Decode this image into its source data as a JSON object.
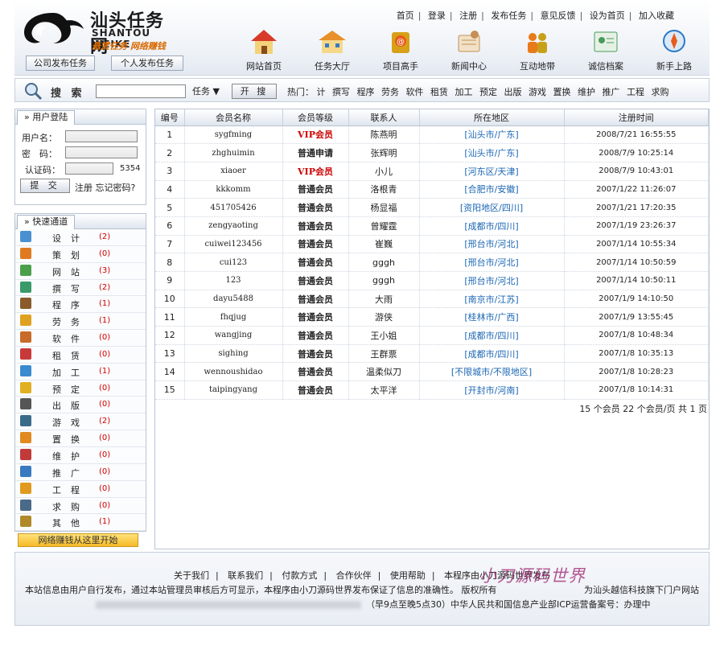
{
  "logo": {
    "cn": "汕头任务网",
    "en": "SHANTOU WEIKE",
    "slogan": "悬赏任务 网络赚钱"
  },
  "publish_buttons": {
    "company": "公司发布任务",
    "personal": "个人发布任务"
  },
  "top_links": [
    "首页",
    "登录",
    "注册",
    "发布任务",
    "意见反馈",
    "设为首页",
    "加入收藏"
  ],
  "nav": [
    {
      "label": "网站首页",
      "icon": "house-icon",
      "color": "#d83a2a"
    },
    {
      "label": "任务大厅",
      "icon": "hall-icon",
      "color": "#e8902a"
    },
    {
      "label": "项目高手",
      "icon": "expert-icon",
      "color": "#d7a018"
    },
    {
      "label": "新闻中心",
      "icon": "news-icon",
      "color": "#c78f55"
    },
    {
      "label": "互动地带",
      "icon": "people-icon",
      "color": "#e87a1a"
    },
    {
      "label": "诚信档案",
      "icon": "certificate-icon",
      "color": "#4a9a5a"
    },
    {
      "label": "新手上路",
      "icon": "compass-icon",
      "color": "#2a78c8"
    }
  ],
  "search": {
    "title": "搜 索",
    "input_value": "",
    "type_value": "任务",
    "button": "开 搜",
    "hot_label": "热门：",
    "hot": [
      "计",
      "撰写",
      "程序",
      "劳务",
      "软件",
      "租赁",
      "加工",
      "预定",
      "出版",
      "游戏",
      "置换",
      "维护",
      "推广",
      "工程",
      "求购"
    ]
  },
  "login": {
    "title": "用户登陆",
    "username_label": "用户名：",
    "password_label": "密　码：",
    "code_label": "认证码：",
    "code": "5354",
    "submit": "提 交",
    "register": "注册",
    "forgot": "忘记密码?"
  },
  "quick": {
    "title": "快速通道",
    "items": [
      {
        "name": "设计",
        "count": "(2)",
        "color": "#4a90d0"
      },
      {
        "name": "策划",
        "count": "(0)",
        "color": "#e07a20"
      },
      {
        "name": "网站",
        "count": "(3)",
        "color": "#4aa04a"
      },
      {
        "name": "撰写",
        "count": "(2)",
        "color": "#3a9a6a"
      },
      {
        "name": "程序",
        "count": "(1)",
        "color": "#8a5a2a"
      },
      {
        "name": "劳务",
        "count": "(1)",
        "color": "#e0a020"
      },
      {
        "name": "软件",
        "count": "(0)",
        "color": "#c86a2a"
      },
      {
        "name": "租赁",
        "count": "(0)",
        "color": "#c83a3a"
      },
      {
        "name": "加工",
        "count": "(1)",
        "color": "#3a8ad0"
      },
      {
        "name": "预定",
        "count": "(0)",
        "color": "#e0b020"
      },
      {
        "name": "出版",
        "count": "(0)",
        "color": "#555555"
      },
      {
        "name": "游戏",
        "count": "(2)",
        "color": "#3a6a8a"
      },
      {
        "name": "置换",
        "count": "(0)",
        "color": "#e08a20"
      },
      {
        "name": "维护",
        "count": "(0)",
        "color": "#c03a3a"
      },
      {
        "name": "推广",
        "count": "(0)",
        "color": "#3a7ac0"
      },
      {
        "name": "工程",
        "count": "(0)",
        "color": "#e09a20"
      },
      {
        "name": "求购",
        "count": "(0)",
        "color": "#4a6a8a"
      },
      {
        "name": "其他",
        "count": "(1)",
        "color": "#b08a2a"
      }
    ],
    "banner": "网络赚钱从这里开始"
  },
  "table": {
    "headers": [
      "编号",
      "会员名称",
      "会员等级",
      "联系人",
      "所在地区",
      "注册时间"
    ],
    "rows": [
      [
        "1",
        "sygfming",
        "VIP会员",
        "陈燕明",
        "[汕头市/广东]",
        "2008/7/21 16:55:55"
      ],
      [
        "2",
        "zhghuimin",
        "普通申请",
        "张辉明",
        "[汕头市/广东]",
        "2008/7/9 10:25:14"
      ],
      [
        "3",
        "xiaoer",
        "VIP会员",
        "小儿",
        "[河东区/天津]",
        "2008/7/9 10:43:01"
      ],
      [
        "4",
        "kkkomm",
        "普通会员",
        "洛根青",
        "[合肥市/安徽]",
        "2007/1/22 11:26:07"
      ],
      [
        "5",
        "451705426",
        "普通会员",
        "杨显福",
        "[资阳地区/四川]",
        "2007/1/21 17:20:35"
      ],
      [
        "6",
        "zengyaoting",
        "普通会员",
        "曾耀霆",
        "[成都市/四川]",
        "2007/1/19 23:26:37"
      ],
      [
        "7",
        "cuiwei123456",
        "普通会员",
        "崔巍",
        "[邢台市/河北]",
        "2007/1/14 10:55:34"
      ],
      [
        "8",
        "cui123",
        "普通会员",
        "gggh",
        "[邢台市/河北]",
        "2007/1/14 10:50:59"
      ],
      [
        "9",
        "123",
        "普通会员",
        "gggh",
        "[邢台市/河北]",
        "2007/1/14 10:50:11"
      ],
      [
        "10",
        "dayu5488",
        "普通会员",
        "大雨",
        "[南京市/江苏]",
        "2007/1/9 14:10:50"
      ],
      [
        "11",
        "fhqjug",
        "普通会员",
        "游侠",
        "[桂林市/广西]",
        "2007/1/9 13:55:45"
      ],
      [
        "12",
        "wangjing",
        "普通会员",
        "王小姐",
        "[成都市/四川]",
        "2007/1/8 10:48:34"
      ],
      [
        "13",
        "sighing",
        "普通会员",
        "王群票",
        "[成都市/四川]",
        "2007/1/8 10:35:13"
      ],
      [
        "14",
        "wennoushidao",
        "普通会员",
        "温柔似刀",
        "[不限城市/不限地区]",
        "2007/1/8 10:28:23"
      ],
      [
        "15",
        "taipingyang",
        "普通会员",
        "太平洋",
        "[开封市/河南]",
        "2007/1/8 10:14:31"
      ]
    ],
    "pager": "15 个会员  22 个会员/页  共 1 页"
  },
  "footer": {
    "links": [
      "关于我们",
      "联系我们",
      "付款方式",
      "合作伙伴",
      "使用帮助",
      "本程序由小刀源码世界发布"
    ],
    "line1": "本站信息由用户自行发布，通过本站管理员审核后方可显示，本程序由小刀源码世界发布保证了信息的准确性。 版权所有",
    "line1_right": "为汕头越信科技旗下门户网站",
    "line2": "（早9点至晚5点30）中华人民共和国信息产业部ICP运营备案号：办理中",
    "watermark": "小刀源码世界"
  },
  "colors": {
    "vip": "#cc0000",
    "area": "#1a66b3",
    "count": "#cc0000",
    "banner": "#f6b928"
  }
}
